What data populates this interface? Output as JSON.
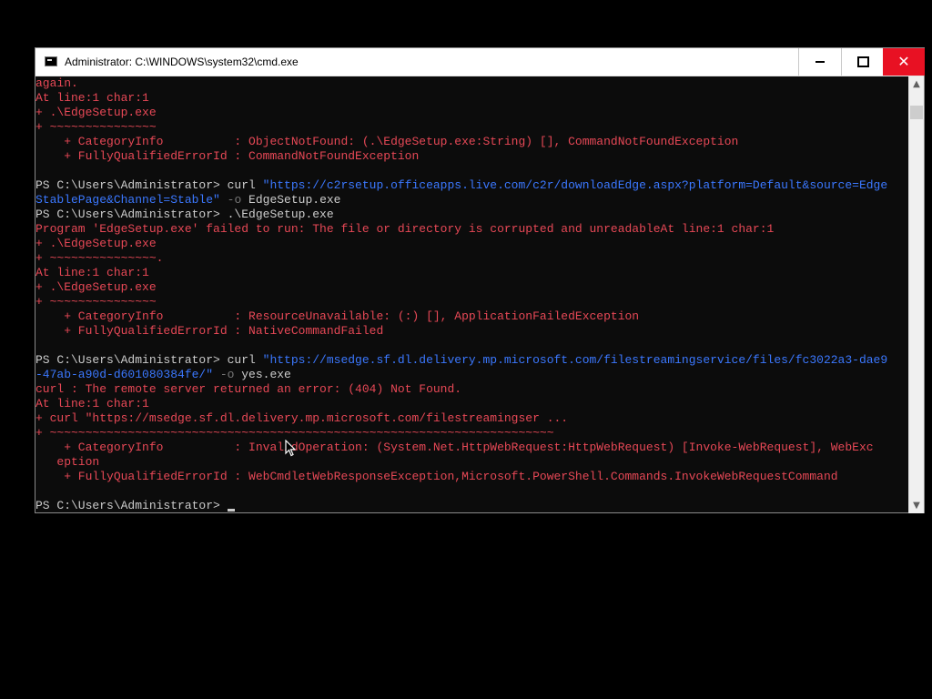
{
  "window": {
    "title": "Administrator: C:\\WINDOWS\\system32\\cmd.exe",
    "minimize_icon": "minimize-icon",
    "maximize_icon": "maximize-icon",
    "close_glyph": "✕"
  },
  "colors": {
    "console_bg": "#0c0c0c",
    "default_text": "#cccccc",
    "error_text": "#e74856",
    "string_text": "#3b78ff",
    "parameter_text": "#767676",
    "close_button": "#e81123"
  },
  "console": {
    "lines": [
      {
        "segments": [
          {
            "t": "again.",
            "c": "err"
          }
        ]
      },
      {
        "segments": [
          {
            "t": "At line:1 char:1",
            "c": "err"
          }
        ]
      },
      {
        "segments": [
          {
            "t": "+ .\\EdgeSetup.exe",
            "c": "err"
          }
        ]
      },
      {
        "segments": [
          {
            "t": "+ ~~~~~~~~~~~~~~~",
            "c": "err"
          }
        ]
      },
      {
        "segments": [
          {
            "t": "    + CategoryInfo          : ObjectNotFound: (.\\EdgeSetup.exe:String) [], CommandNotFoundException",
            "c": "err"
          }
        ]
      },
      {
        "segments": [
          {
            "t": "    + FullyQualifiedErrorId : CommandNotFoundException",
            "c": "err"
          }
        ]
      },
      {
        "segments": [
          {
            "t": "",
            "c": ""
          }
        ]
      },
      {
        "segments": [
          {
            "t": "PS C:\\Users\\Administrator> curl ",
            "c": ""
          },
          {
            "t": "\"https://c2rsetup.officeapps.live.com/c2r/downloadEdge.aspx?platform=Default&source=Edge",
            "c": "str"
          }
        ]
      },
      {
        "segments": [
          {
            "t": "StablePage&Channel=Stable\"",
            "c": "str"
          },
          {
            "t": " -o",
            "c": "param"
          },
          {
            "t": " EdgeSetup.exe",
            "c": ""
          }
        ]
      },
      {
        "segments": [
          {
            "t": "PS C:\\Users\\Administrator> .\\EdgeSetup.exe",
            "c": ""
          }
        ]
      },
      {
        "segments": [
          {
            "t": "Program 'EdgeSetup.exe' failed to run: The file or directory is corrupted and unreadableAt line:1 char:1",
            "c": "err"
          }
        ]
      },
      {
        "segments": [
          {
            "t": "+ .\\EdgeSetup.exe",
            "c": "err"
          }
        ]
      },
      {
        "segments": [
          {
            "t": "+ ~~~~~~~~~~~~~~~.",
            "c": "err"
          }
        ]
      },
      {
        "segments": [
          {
            "t": "At line:1 char:1",
            "c": "err"
          }
        ]
      },
      {
        "segments": [
          {
            "t": "+ .\\EdgeSetup.exe",
            "c": "err"
          }
        ]
      },
      {
        "segments": [
          {
            "t": "+ ~~~~~~~~~~~~~~~",
            "c": "err"
          }
        ]
      },
      {
        "segments": [
          {
            "t": "    + CategoryInfo          : ResourceUnavailable: (:) [], ApplicationFailedException",
            "c": "err"
          }
        ]
      },
      {
        "segments": [
          {
            "t": "    + FullyQualifiedErrorId : NativeCommandFailed",
            "c": "err"
          }
        ]
      },
      {
        "segments": [
          {
            "t": "",
            "c": ""
          }
        ]
      },
      {
        "segments": [
          {
            "t": "PS C:\\Users\\Administrator> curl ",
            "c": ""
          },
          {
            "t": "\"https://msedge.sf.dl.delivery.mp.microsoft.com/filestreamingservice/files/fc3022a3-dae9",
            "c": "str"
          }
        ]
      },
      {
        "segments": [
          {
            "t": "-47ab-a90d-d601080384fe/\"",
            "c": "str"
          },
          {
            "t": " -o",
            "c": "param"
          },
          {
            "t": " yes.exe",
            "c": ""
          }
        ]
      },
      {
        "segments": [
          {
            "t": "curl : The remote server returned an error: (404) Not Found.",
            "c": "err"
          }
        ]
      },
      {
        "segments": [
          {
            "t": "At line:1 char:1",
            "c": "err"
          }
        ]
      },
      {
        "segments": [
          {
            "t": "+ curl \"https://msedge.sf.dl.delivery.mp.microsoft.com/filestreamingser ...",
            "c": "err"
          }
        ]
      },
      {
        "segments": [
          {
            "t": "+ ~~~~~~~~~~~~~~~~~~~~~~~~~~~~~~~~~~~~~~~~~~~~~~~~~~~~~~~~~~~~~~~~~~~~~~~",
            "c": "err"
          }
        ]
      },
      {
        "segments": [
          {
            "t": "    + CategoryInfo          : InvalidOperation: (System.Net.HttpWebRequest:HttpWebRequest) [Invoke-WebRequest], WebExc",
            "c": "err"
          }
        ]
      },
      {
        "segments": [
          {
            "t": "   eption",
            "c": "err"
          }
        ]
      },
      {
        "segments": [
          {
            "t": "    + FullyQualifiedErrorId : WebCmdletWebResponseException,Microsoft.PowerShell.Commands.InvokeWebRequestCommand",
            "c": "err"
          }
        ]
      },
      {
        "segments": [
          {
            "t": "",
            "c": ""
          }
        ]
      }
    ],
    "prompt": "PS C:\\Users\\Administrator> "
  },
  "scrollbar": {
    "up_glyph": "▲",
    "down_glyph": "▼"
  }
}
